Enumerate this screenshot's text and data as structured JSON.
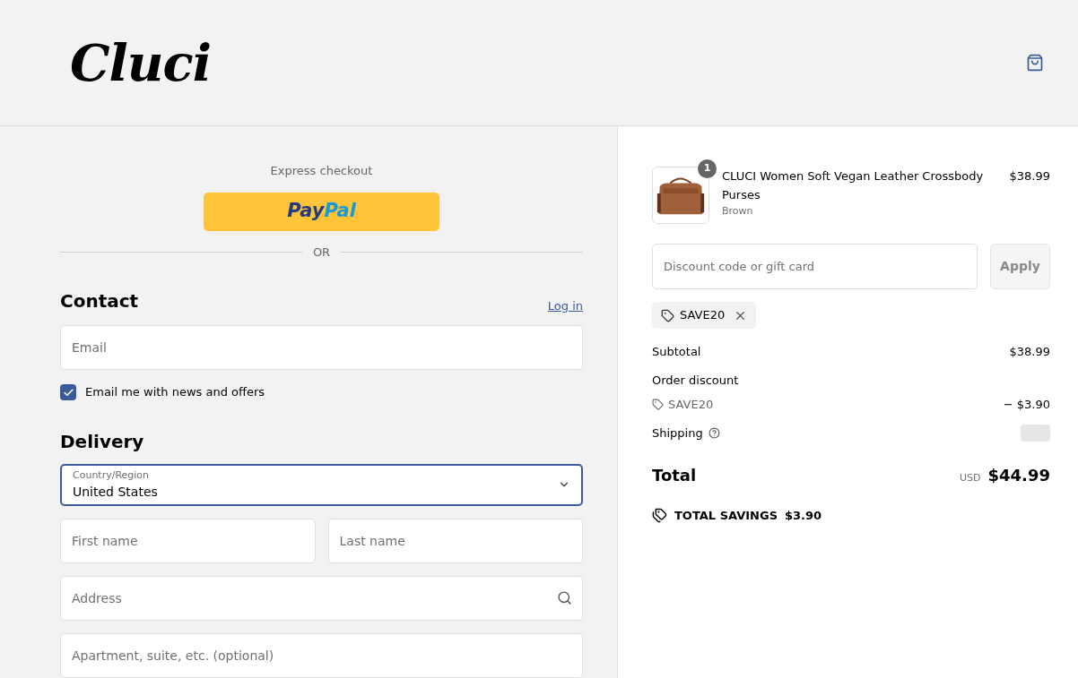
{
  "header": {
    "logo": "Cluci"
  },
  "express": {
    "title": "Express checkout",
    "paypal": [
      "Pay",
      "Pal"
    ],
    "divider": "OR"
  },
  "contact": {
    "heading": "Contact",
    "login": "Log in",
    "email": {
      "placeholder": "Email"
    },
    "newsletter": {
      "label": "Email me with news and offers",
      "checked": true
    }
  },
  "delivery": {
    "heading": "Delivery",
    "country": {
      "label": "Country/Region",
      "value": "United States"
    },
    "fields": [
      {
        "placeholder": "First name",
        "kind": "half"
      },
      {
        "placeholder": "Last name",
        "kind": "half"
      },
      {
        "placeholder": "Address",
        "kind": "search"
      },
      {
        "placeholder": "Apartment, suite, etc. (optional)",
        "kind": "full"
      }
    ]
  },
  "summary": {
    "item": {
      "quantity": "1",
      "name": "CLUCI Women Soft Vegan Leather Crossbody Purses",
      "variant": "Brown",
      "price": "$38.99"
    },
    "discount": {
      "placeholder": "Discount code or gift card",
      "button": "Apply"
    },
    "applied_code": "SAVE20",
    "subtotal": {
      "label": "Subtotal",
      "value": "$38.99"
    },
    "order_discount": {
      "label": "Order discount",
      "code": "SAVE20",
      "value": "− $3.90"
    },
    "shipping": {
      "label": "Shipping"
    },
    "total": {
      "label": "Total",
      "currency": "USD",
      "value": "$44.99"
    },
    "savings": {
      "label": "TOTAL SAVINGS",
      "value": "$3.90"
    }
  }
}
